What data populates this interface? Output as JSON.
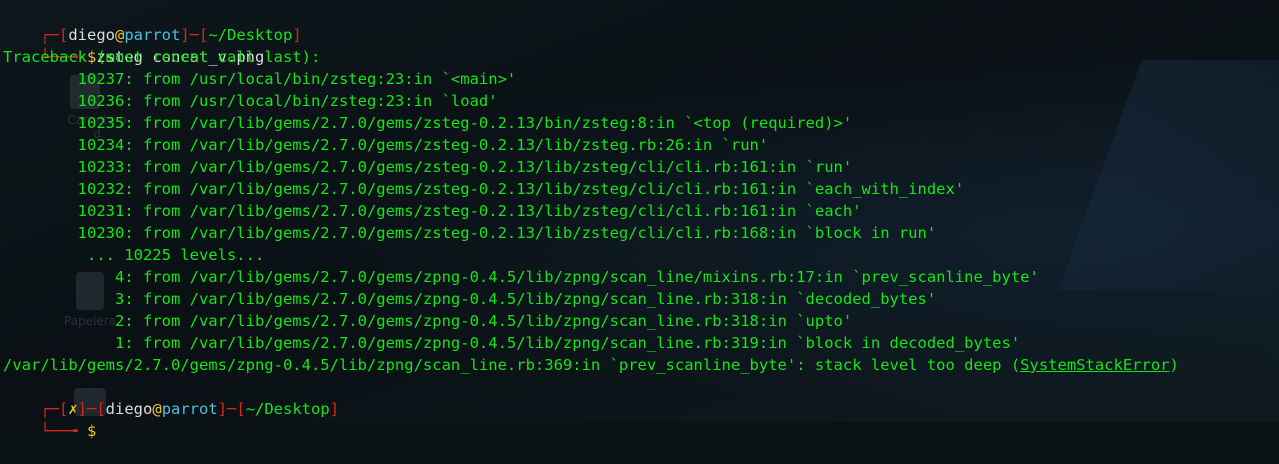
{
  "desktop": {
    "icon1_label": "Carpeta p",
    "icon1_label2": "d",
    "icon2_label": "Papelera"
  },
  "terminal": {
    "prompt1": {
      "open": "┌─[",
      "user": "diego",
      "at": "@",
      "host": "parrot",
      "mid": "]─[",
      "path": "~/Desktop",
      "close": "]",
      "corner2": "└──╼ ",
      "dollar": "$",
      "command": "zsteg concat_v.png"
    },
    "traceback_header": "Traceback (most recent call last):",
    "frames": [
      "        10237: from /usr/local/bin/zsteg:23:in `<main>'",
      "        10236: from /usr/local/bin/zsteg:23:in `load'",
      "        10235: from /var/lib/gems/2.7.0/gems/zsteg-0.2.13/bin/zsteg:8:in `<top (required)>'",
      "        10234: from /var/lib/gems/2.7.0/gems/zsteg-0.2.13/lib/zsteg.rb:26:in `run'",
      "        10233: from /var/lib/gems/2.7.0/gems/zsteg-0.2.13/lib/zsteg/cli/cli.rb:161:in `run'",
      "        10232: from /var/lib/gems/2.7.0/gems/zsteg-0.2.13/lib/zsteg/cli/cli.rb:161:in `each_with_index'",
      "        10231: from /var/lib/gems/2.7.0/gems/zsteg-0.2.13/lib/zsteg/cli/cli.rb:161:in `each'",
      "        10230: from /var/lib/gems/2.7.0/gems/zsteg-0.2.13/lib/zsteg/cli/cli.rb:168:in `block in run'",
      "         ... 10225 levels...",
      "            4: from /var/lib/gems/2.7.0/gems/zpng-0.4.5/lib/zpng/scan_line/mixins.rb:17:in `prev_scanline_byte'",
      "            3: from /var/lib/gems/2.7.0/gems/zpng-0.4.5/lib/zpng/scan_line.rb:318:in `decoded_bytes'",
      "            2: from /var/lib/gems/2.7.0/gems/zpng-0.4.5/lib/zpng/scan_line.rb:318:in `upto'",
      "            1: from /var/lib/gems/2.7.0/gems/zpng-0.4.5/lib/zpng/scan_line.rb:319:in `block in decoded_bytes'"
    ],
    "error_line_main": "/var/lib/gems/2.7.0/gems/zpng-0.4.5/lib/zpng/scan_line.rb:369:in `prev_scanline_byte': stack level too deep (",
    "error_class": "SystemStackError",
    "error_close": ")",
    "prompt2": {
      "open": "┌─[",
      "x": "✗",
      "mid1": "]─[",
      "user": "diego",
      "at": "@",
      "host": "parrot",
      "mid2": "]─[",
      "path": "~/Desktop",
      "close": "]",
      "corner2": "└──╼ ",
      "dollar": "$"
    }
  },
  "colors": {
    "background": "#0b1216",
    "prompt_red": "#d9261c",
    "output_green": "#14e614",
    "host_cyan": "#48c1e3",
    "dollar_yellow": "#f0c32a"
  }
}
